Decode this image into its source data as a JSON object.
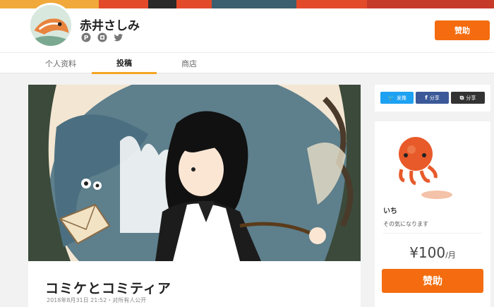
{
  "creator": {
    "name": "赤井さしみ"
  },
  "header": {
    "sponsor_label": "赞助"
  },
  "tabs": [
    {
      "label": "个人资料"
    },
    {
      "label": "投稿"
    },
    {
      "label": "商店"
    }
  ],
  "post": {
    "title": "コミケとコミティア",
    "meta": "2018年8月31日 21:52・对所有人公开"
  },
  "share": {
    "twitter_label": "发推",
    "facebook_label": "分享",
    "copy_label": "分享"
  },
  "plan": {
    "name": "いち",
    "description": "その気になります",
    "price": "¥100",
    "unit": "/月",
    "sponsor_label": "赞助"
  },
  "colors": {
    "accent": "#f46c0f",
    "tab_underline": "#f5a623",
    "twitter": "#1da1f2",
    "facebook": "#3b5998"
  },
  "icons": [
    "pixiv-icon",
    "booth-icon",
    "twitter-icon"
  ]
}
